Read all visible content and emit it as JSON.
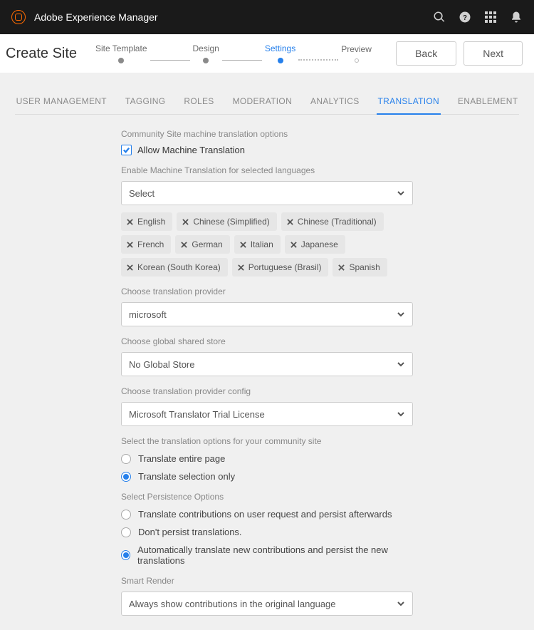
{
  "header": {
    "app_title": "Adobe Experience Manager"
  },
  "wizard": {
    "title": "Create Site",
    "steps": [
      "Site Template",
      "Design",
      "Settings",
      "Preview"
    ],
    "active_index": 2,
    "back_label": "Back",
    "next_label": "Next"
  },
  "tabs": {
    "items": [
      "USER MANAGEMENT",
      "TAGGING",
      "ROLES",
      "MODERATION",
      "ANALYTICS",
      "TRANSLATION",
      "ENABLEMENT"
    ],
    "active_index": 5
  },
  "form": {
    "section_machine": "Community Site machine translation options",
    "allow_label": "Allow Machine Translation",
    "enable_label": "Enable Machine Translation for selected languages",
    "select_placeholder": "Select",
    "languages": [
      "English",
      "Chinese (Simplified)",
      "Chinese (Traditional)",
      "French",
      "German",
      "Italian",
      "Japanese",
      "Korean (South Korea)",
      "Portuguese (Brasil)",
      "Spanish"
    ],
    "provider_label": "Choose translation provider",
    "provider_value": "microsoft",
    "store_label": "Choose global shared store",
    "store_value": "No Global Store",
    "config_label": "Choose translation provider config",
    "config_value": "Microsoft Translator Trial License",
    "options_label": "Select the translation options for your community site",
    "opt_entire": "Translate entire page",
    "opt_selection": "Translate selection only",
    "persist_label": "Select Persistence Options",
    "persist_a": "Translate contributions on user request and persist afterwards",
    "persist_b": "Don't persist translations.",
    "persist_c": "Automatically translate new contributions and persist the new translations",
    "smart_label": "Smart Render",
    "smart_value": "Always show contributions in the original language"
  }
}
